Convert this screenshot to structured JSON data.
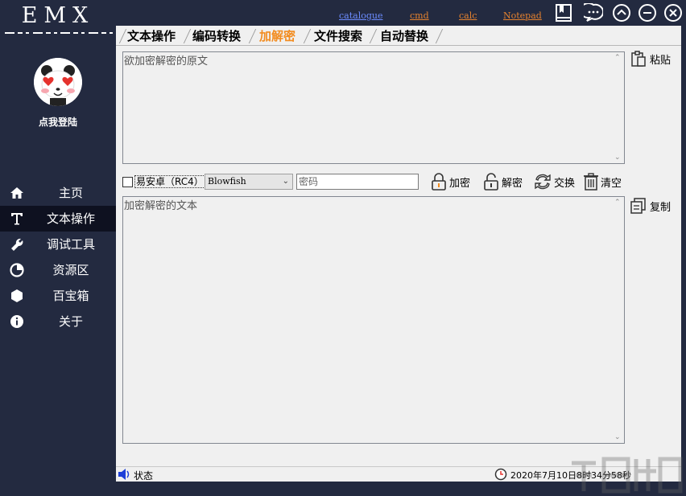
{
  "app": {
    "logo_text": "EMX",
    "login_label": "点我登陆"
  },
  "nav": {
    "items": [
      {
        "label": "主页",
        "icon": "home-icon"
      },
      {
        "label": "文本操作",
        "icon": "text-icon",
        "active": true
      },
      {
        "label": "调试工具",
        "icon": "wrench-icon"
      },
      {
        "label": "资源区",
        "icon": "pie-chart-icon"
      },
      {
        "label": "百宝箱",
        "icon": "hexagon-icon"
      },
      {
        "label": "关于",
        "icon": "info-icon"
      }
    ]
  },
  "toplinks": {
    "catalogue": "catalogue",
    "cmd": "cmd",
    "calc": "calc",
    "notepad": "Notepad"
  },
  "colors": {
    "sidebar_bg": "#232a40",
    "active_item_bg": "#0e1120",
    "active_tab": "#f28c20",
    "link_blue": "#6c8cff",
    "link_orange": "#e5822f"
  },
  "tabs": [
    {
      "label": "文本操作"
    },
    {
      "label": "编码转换"
    },
    {
      "label": "加解密",
      "active": true
    },
    {
      "label": "文件搜索"
    },
    {
      "label": "自动替换"
    }
  ],
  "input_box": {
    "placeholder": "欲加密解密的原文"
  },
  "paste_label": "粘贴",
  "options": {
    "rc4_label": "易安卓（RC4）",
    "rc4_checked": false,
    "algorithm": "Blowfish",
    "password_placeholder": "密码"
  },
  "actions": {
    "encrypt": "加密",
    "decrypt": "解密",
    "swap": "交换",
    "clear": "清空"
  },
  "output_box": {
    "placeholder": "加密解密的文本"
  },
  "copy_label": "复制",
  "status": {
    "label": "状态",
    "datetime": "2020年7月10日8时34分58秒"
  }
}
